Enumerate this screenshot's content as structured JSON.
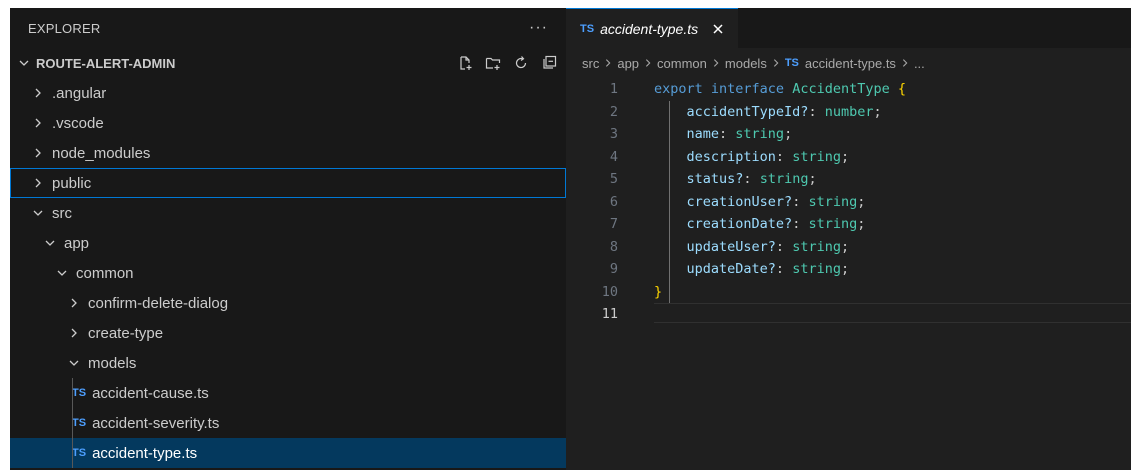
{
  "explorer": {
    "title": "EXPLORER",
    "more_label": "···",
    "section_title": "ROUTE-ALERT-ADMIN",
    "actions": [
      "new-file-icon",
      "new-folder-icon",
      "refresh-icon",
      "collapse-all-icon"
    ],
    "tree": [
      {
        "label": ".angular",
        "type": "folder",
        "expanded": false
      },
      {
        "label": ".vscode",
        "type": "folder",
        "expanded": false
      },
      {
        "label": "node_modules",
        "type": "folder",
        "expanded": false
      },
      {
        "label": "public",
        "type": "folder",
        "expanded": false,
        "focused": true
      },
      {
        "label": "src",
        "type": "folder",
        "expanded": true
      },
      {
        "label": "app",
        "type": "folder",
        "expanded": true
      },
      {
        "label": "common",
        "type": "folder",
        "expanded": true
      },
      {
        "label": "confirm-delete-dialog",
        "type": "folder",
        "expanded": false
      },
      {
        "label": "create-type",
        "type": "folder",
        "expanded": false
      },
      {
        "label": "models",
        "type": "folder",
        "expanded": true
      },
      {
        "label": "accident-cause.ts",
        "type": "file",
        "badge": "TS"
      },
      {
        "label": "accident-severity.ts",
        "type": "file",
        "badge": "TS"
      },
      {
        "label": "accident-type.ts",
        "type": "file",
        "badge": "TS",
        "selected": true
      }
    ]
  },
  "editor": {
    "tab": {
      "badge": "TS",
      "label": "accident-type.ts"
    },
    "breadcrumb": [
      "src",
      "app",
      "common",
      "models",
      "accident-type.ts",
      "..."
    ],
    "breadcrumb_badge": "TS",
    "lines": [
      {
        "num": "1",
        "kw": "export interface",
        "name": "AccidentType",
        "brace": "{"
      },
      {
        "num": "2",
        "prop": "accidentTypeId?",
        "type": "number"
      },
      {
        "num": "3",
        "prop": "name",
        "type": "string"
      },
      {
        "num": "4",
        "prop": "description",
        "type": "string"
      },
      {
        "num": "5",
        "prop": "status?",
        "type": "string"
      },
      {
        "num": "6",
        "prop": "creationUser?",
        "type": "string"
      },
      {
        "num": "7",
        "prop": "creationDate?",
        "type": "string"
      },
      {
        "num": "8",
        "prop": "updateUser?",
        "type": "string"
      },
      {
        "num": "9",
        "prop": "updateDate?",
        "type": "string"
      },
      {
        "num": "10",
        "brace": "}"
      },
      {
        "num": "11"
      }
    ],
    "active_line": "11"
  },
  "colors": {
    "keyword": "#569cd6",
    "type": "#4ec9b0",
    "property": "#9cdcfe",
    "brace": "#ffd700",
    "ts_badge": "#4d9fff",
    "selection": "#04395e",
    "focus_border": "#0078d4"
  }
}
